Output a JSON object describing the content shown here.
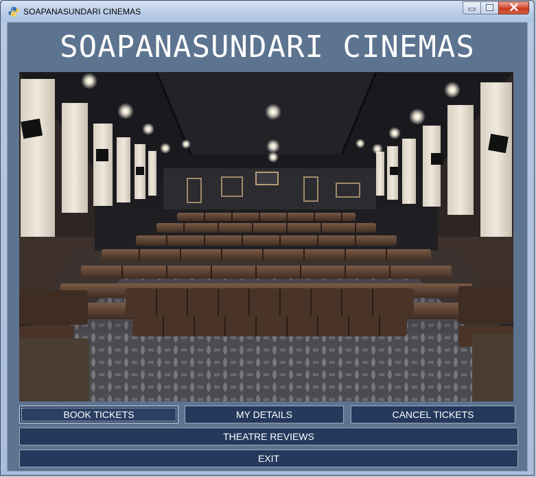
{
  "window": {
    "title": "SOAPANASUNDARI CINEMAS",
    "minimize_symbol": "—",
    "maximize_symbol": "□",
    "close_symbol": "✕"
  },
  "header": {
    "title": "SOAPANASUNDARI CINEMAS"
  },
  "image": {
    "subject": "cinema-auditorium-photo"
  },
  "buttons": {
    "book": "BOOK TICKETS",
    "details": "MY DETAILS",
    "cancel": "CANCEL TICKETS",
    "reviews": "THEATRE REVIEWS",
    "exit": "EXIT"
  },
  "colors": {
    "panel_bg": "#5d7490",
    "button_bg": "#24395c",
    "button_text": "#ffffff",
    "close_button": "#c53a20"
  }
}
